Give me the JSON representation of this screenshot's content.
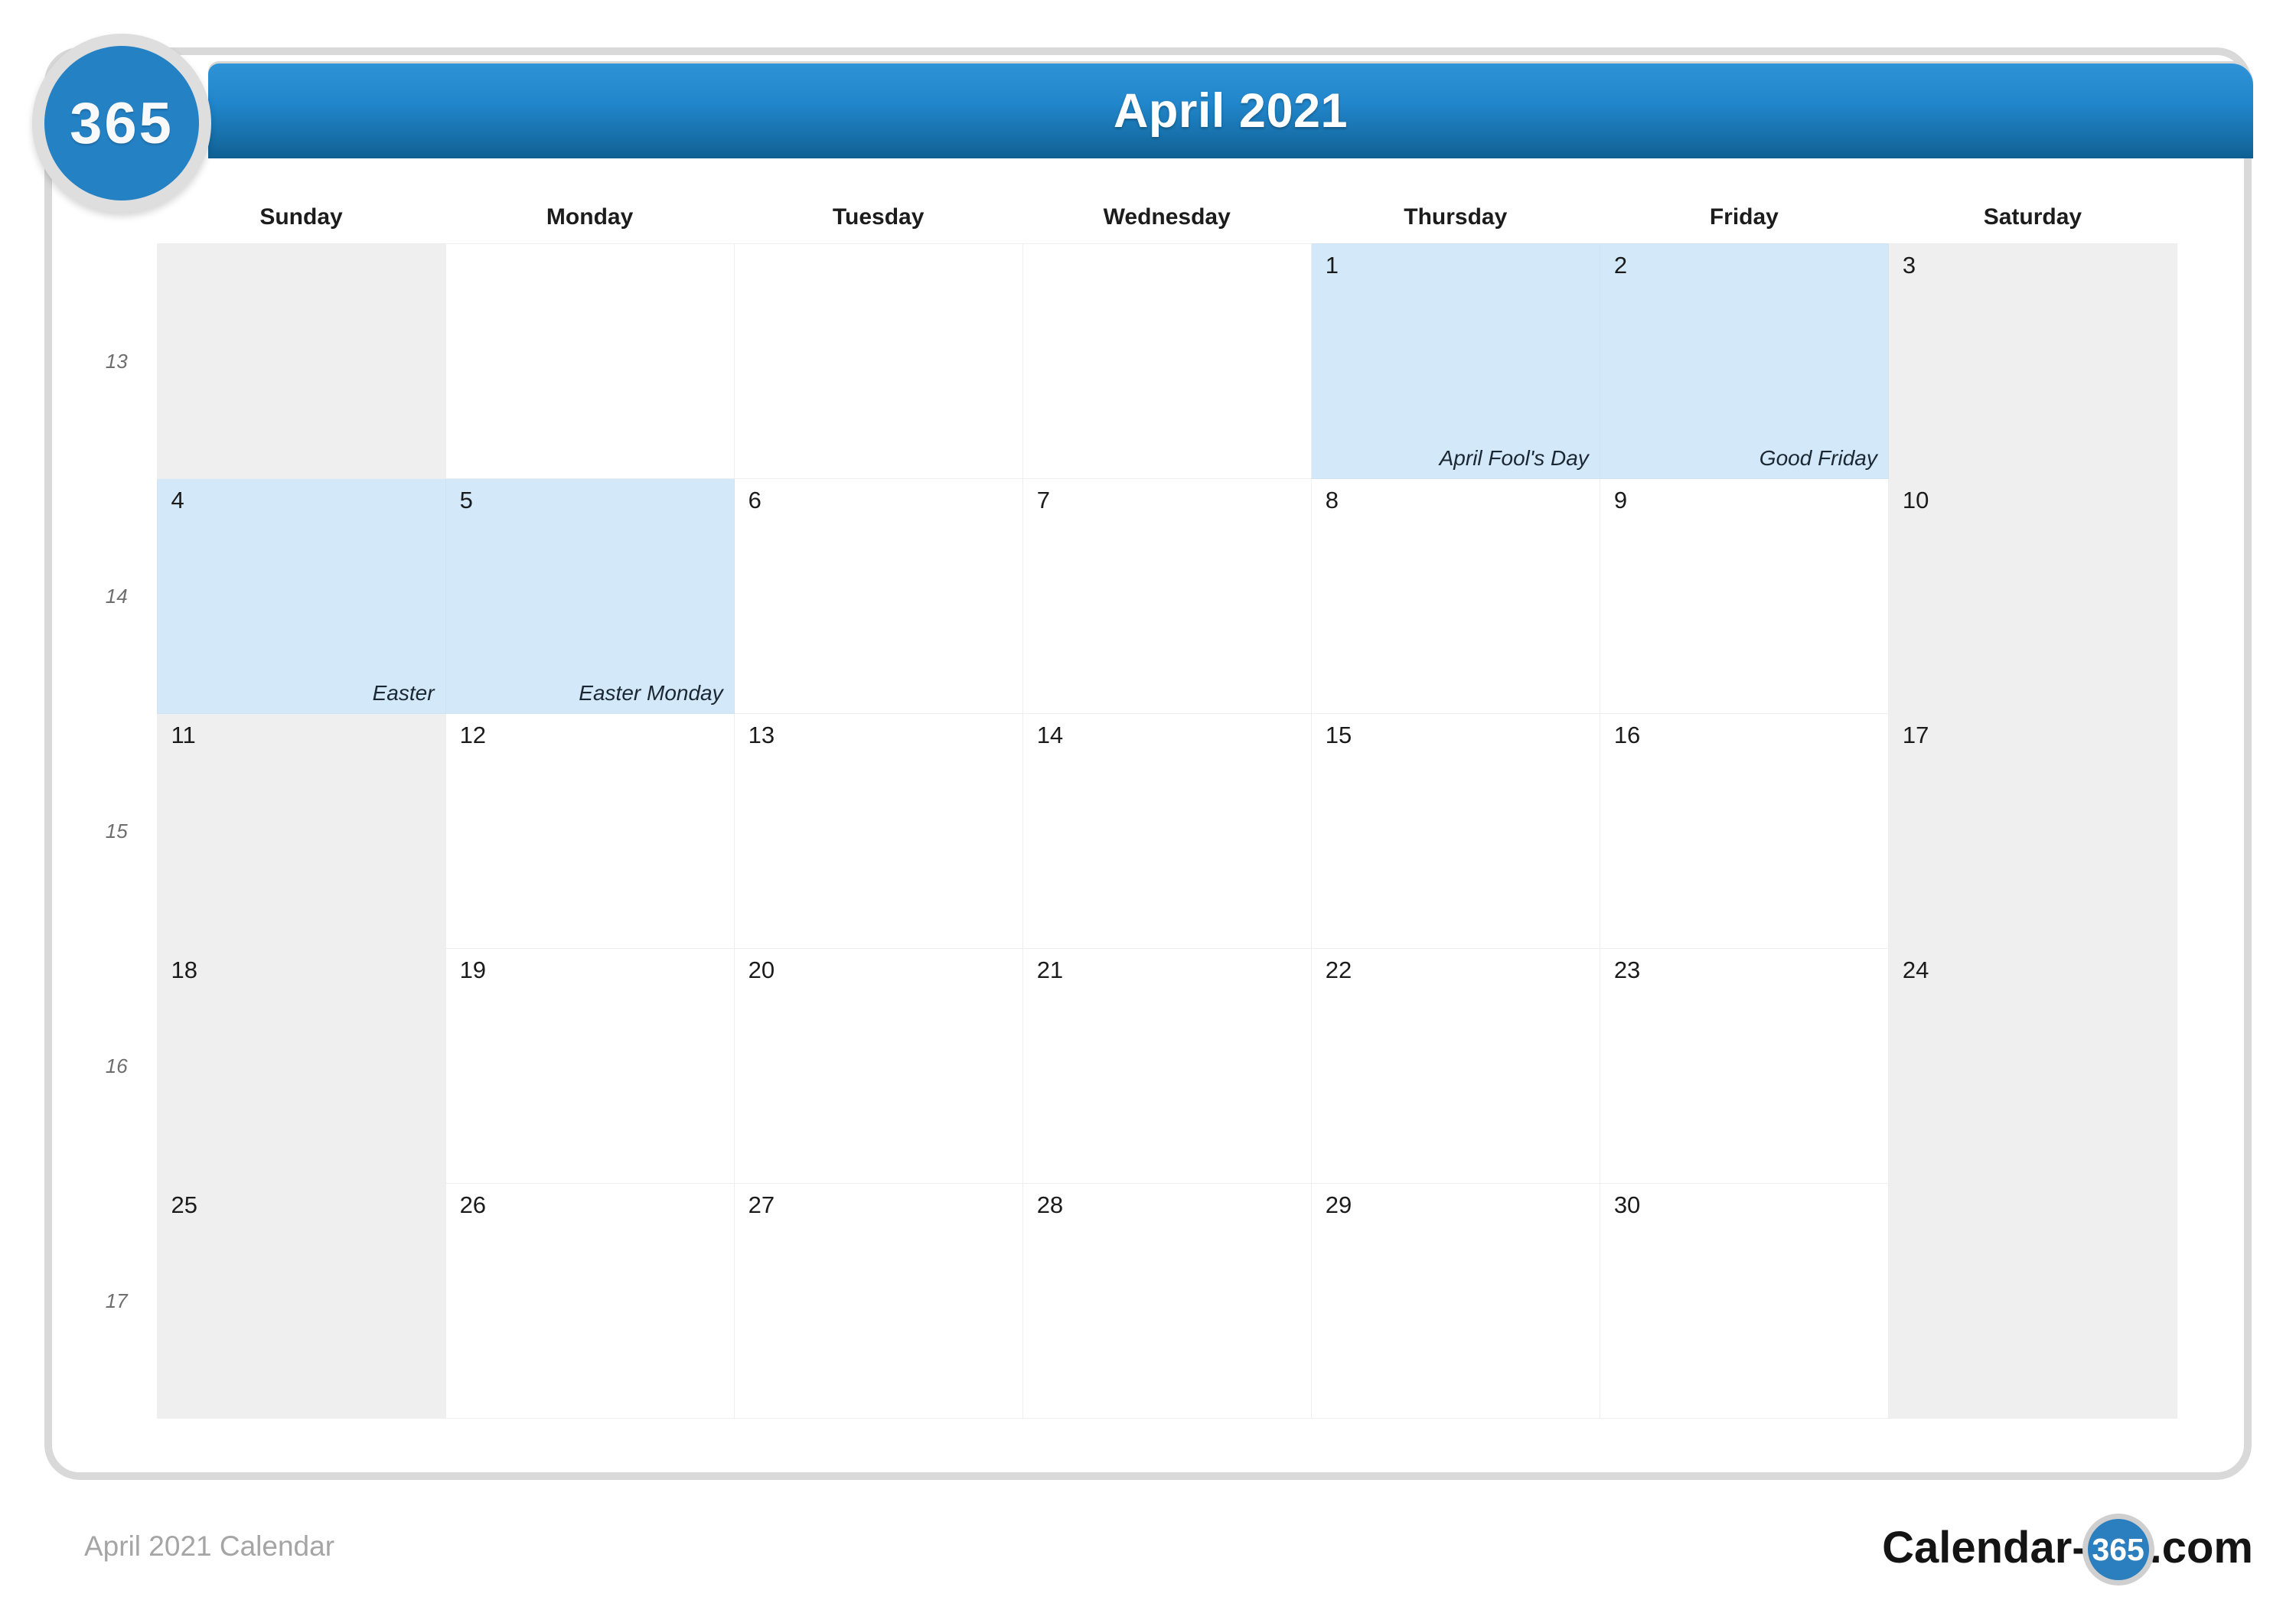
{
  "badge": {
    "text": "365"
  },
  "header": {
    "title": "April 2021"
  },
  "watermark": {
    "text": "365"
  },
  "colors": {
    "header_gradient_top": "#2e93d6",
    "header_gradient_bottom": "#0e5f93",
    "badge_blue": "#2481c4",
    "holiday_cell": "#d3e8f8",
    "weekend_cell": "#efefef",
    "frame_border": "#d9d9d9",
    "footer_text": "#a5a5a5"
  },
  "weekday_headers": [
    "Sunday",
    "Monday",
    "Tuesday",
    "Wednesday",
    "Thursday",
    "Friday",
    "Saturday"
  ],
  "week_numbers": [
    "13",
    "14",
    "15",
    "16",
    "17"
  ],
  "weeks": [
    {
      "week_number": "13",
      "days": [
        {
          "num": "",
          "holiday": "",
          "weekend": true,
          "is_holiday": false,
          "empty": true
        },
        {
          "num": "",
          "holiday": "",
          "weekend": false,
          "is_holiday": false,
          "empty": true
        },
        {
          "num": "",
          "holiday": "",
          "weekend": false,
          "is_holiday": false,
          "empty": true
        },
        {
          "num": "",
          "holiday": "",
          "weekend": false,
          "is_holiday": false,
          "empty": true
        },
        {
          "num": "1",
          "holiday": "April Fool's Day",
          "weekend": false,
          "is_holiday": true,
          "empty": false
        },
        {
          "num": "2",
          "holiday": "Good Friday",
          "weekend": false,
          "is_holiday": true,
          "empty": false
        },
        {
          "num": "3",
          "holiday": "",
          "weekend": true,
          "is_holiday": false,
          "empty": false
        }
      ]
    },
    {
      "week_number": "14",
      "days": [
        {
          "num": "4",
          "holiday": "Easter",
          "weekend": true,
          "is_holiday": true,
          "empty": false
        },
        {
          "num": "5",
          "holiday": "Easter Monday",
          "weekend": false,
          "is_holiday": true,
          "empty": false
        },
        {
          "num": "6",
          "holiday": "",
          "weekend": false,
          "is_holiday": false,
          "empty": false
        },
        {
          "num": "7",
          "holiday": "",
          "weekend": false,
          "is_holiday": false,
          "empty": false
        },
        {
          "num": "8",
          "holiday": "",
          "weekend": false,
          "is_holiday": false,
          "empty": false
        },
        {
          "num": "9",
          "holiday": "",
          "weekend": false,
          "is_holiday": false,
          "empty": false
        },
        {
          "num": "10",
          "holiday": "",
          "weekend": true,
          "is_holiday": false,
          "empty": false
        }
      ]
    },
    {
      "week_number": "15",
      "days": [
        {
          "num": "11",
          "holiday": "",
          "weekend": true,
          "is_holiday": false,
          "empty": false
        },
        {
          "num": "12",
          "holiday": "",
          "weekend": false,
          "is_holiday": false,
          "empty": false
        },
        {
          "num": "13",
          "holiday": "",
          "weekend": false,
          "is_holiday": false,
          "empty": false
        },
        {
          "num": "14",
          "holiday": "",
          "weekend": false,
          "is_holiday": false,
          "empty": false
        },
        {
          "num": "15",
          "holiday": "",
          "weekend": false,
          "is_holiday": false,
          "empty": false
        },
        {
          "num": "16",
          "holiday": "",
          "weekend": false,
          "is_holiday": false,
          "empty": false
        },
        {
          "num": "17",
          "holiday": "",
          "weekend": true,
          "is_holiday": false,
          "empty": false
        }
      ]
    },
    {
      "week_number": "16",
      "days": [
        {
          "num": "18",
          "holiday": "",
          "weekend": true,
          "is_holiday": false,
          "empty": false
        },
        {
          "num": "19",
          "holiday": "",
          "weekend": false,
          "is_holiday": false,
          "empty": false
        },
        {
          "num": "20",
          "holiday": "",
          "weekend": false,
          "is_holiday": false,
          "empty": false
        },
        {
          "num": "21",
          "holiday": "",
          "weekend": false,
          "is_holiday": false,
          "empty": false
        },
        {
          "num": "22",
          "holiday": "",
          "weekend": false,
          "is_holiday": false,
          "empty": false
        },
        {
          "num": "23",
          "holiday": "",
          "weekend": false,
          "is_holiday": false,
          "empty": false
        },
        {
          "num": "24",
          "holiday": "",
          "weekend": true,
          "is_holiday": false,
          "empty": false
        }
      ]
    },
    {
      "week_number": "17",
      "days": [
        {
          "num": "25",
          "holiday": "",
          "weekend": true,
          "is_holiday": false,
          "empty": false
        },
        {
          "num": "26",
          "holiday": "",
          "weekend": false,
          "is_holiday": false,
          "empty": false
        },
        {
          "num": "27",
          "holiday": "",
          "weekend": false,
          "is_holiday": false,
          "empty": false
        },
        {
          "num": "28",
          "holiday": "",
          "weekend": false,
          "is_holiday": false,
          "empty": false
        },
        {
          "num": "29",
          "holiday": "",
          "weekend": false,
          "is_holiday": false,
          "empty": false
        },
        {
          "num": "30",
          "holiday": "",
          "weekend": false,
          "is_holiday": false,
          "empty": false
        },
        {
          "num": "",
          "holiday": "",
          "weekend": true,
          "is_holiday": false,
          "empty": true
        }
      ]
    }
  ],
  "footer": {
    "caption": "April 2021 Calendar",
    "logo_left": "Calendar-",
    "logo_circle": "365",
    "logo_right": ".com"
  }
}
